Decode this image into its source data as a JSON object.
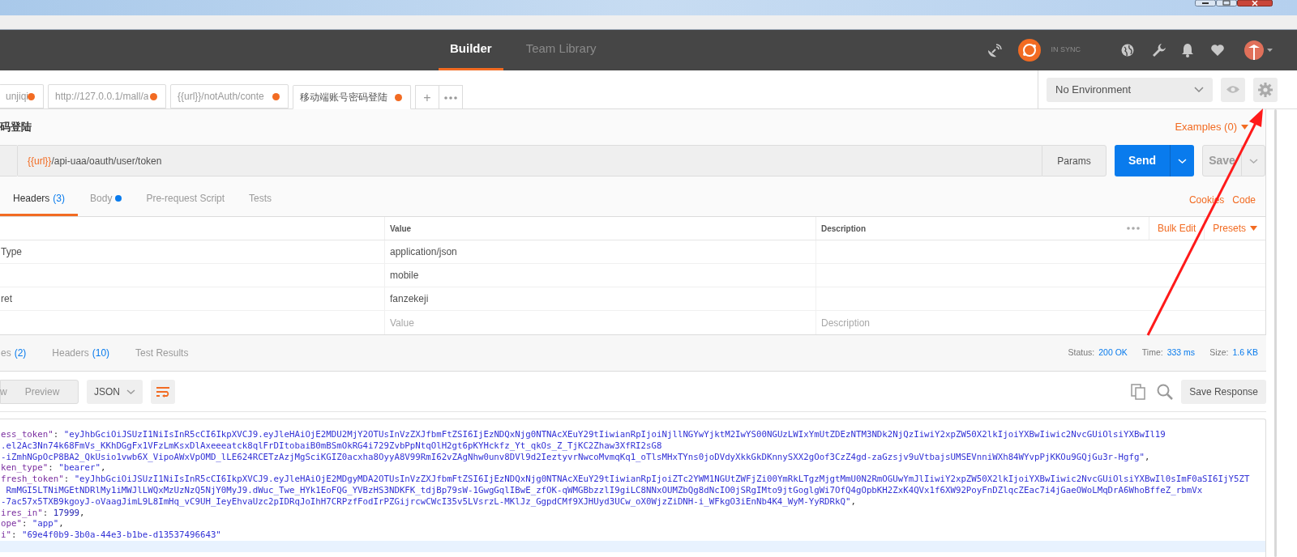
{
  "header": {
    "nav_tabs": [
      {
        "label": "Builder",
        "selected": true
      },
      {
        "label": "Team Library",
        "selected": false
      }
    ],
    "sync_status": "IN SYNC"
  },
  "request_tabs": [
    {
      "label": "unjiqi",
      "unsaved": true,
      "selected": false
    },
    {
      "label": "http://127.0.0.1/mall/a",
      "unsaved": true,
      "selected": false
    },
    {
      "label": "{{url}}/notAuth/conte",
      "unsaved": true,
      "selected": false
    },
    {
      "label": "移动端账号密码登陆",
      "unsaved": true,
      "selected": true
    }
  ],
  "new_tab": "+",
  "environment": {
    "value": "No Environment"
  },
  "request": {
    "title": "码登陆",
    "examples": "Examples (0)",
    "url_variable": "{{url}}",
    "url_path": "/api-uaa/oauth/user/token",
    "params": "Params",
    "send": "Send",
    "save": "Save"
  },
  "editor_tabs": [
    {
      "label": "Headers",
      "count": "(3)",
      "has_content": false,
      "selected": true
    },
    {
      "label": "Body",
      "has_content": true,
      "selected": false
    },
    {
      "label": "Pre-request Script",
      "has_content": false,
      "selected": false
    },
    {
      "label": "Tests",
      "has_content": false,
      "selected": false
    }
  ],
  "editor_links": [
    "Cookies",
    "Code"
  ],
  "headers_table": {
    "columns": [
      "Value",
      "Description"
    ],
    "actions": [
      "Bulk Edit",
      "Presets"
    ],
    "rows": [
      {
        "key": "Type",
        "value": "application/json"
      },
      {
        "value": "mobile"
      },
      {
        "key": "ret",
        "value": "fanzekeji"
      }
    ],
    "new_row": {
      "value_placeholder": "Value",
      "description_placeholder": "Description"
    }
  },
  "response": {
    "tabs": [
      {
        "label": "es",
        "count": "(2)"
      },
      {
        "label": "Headers",
        "count": "(10)"
      },
      {
        "label": "Test Results"
      }
    ],
    "status_label": "Status:",
    "status": "200 OK",
    "time_label": "Time:",
    "time": "333 ms",
    "size_label": "Size:",
    "size": "1.6 KB",
    "view_modes": [
      "w",
      "Preview"
    ],
    "format": "JSON",
    "save": "Save Response",
    "body_lines": [
      [
        {
          "kind": "key",
          "text": "ess_token\""
        },
        {
          "kind": "punct",
          "text": ": "
        },
        {
          "kind": "string",
          "text": "\"eyJhbGciOiJSUzI1NiIsInR5cCI6IkpXVCJ9.eyJleHAiOjE2MDU2MjY2OTUsInVzZXJfbmFtZSI6IjEzNDQxNjg0NTNAcXEuY29tIiwianRpIjoiNjllNGYwYjktM2IwYS00NGUzLWIxYmUtZDEzNTM3NDk2NjQzIiwiY2xpZW50X2lkIjoiYXBwIiwic2NvcGUiOlsiYXBwIl19"
        }
      ],
      [
        {
          "kind": "string",
          "text": ".el2Ac3Nn74k68FmVs_KKhDGgFx1VFzLmKsxDlAxeeeatck8qlFrDItobaiB0mBSmOkRG4i729ZvbPpNtqOlH2gt6pKYHckfz_Yt_qkOs_Z_TjKC2Zhaw3XfRI2sG8"
        }
      ],
      [
        {
          "kind": "string",
          "text": "-iZmhNGpOcP8BA2_QkUsio1vwb6X_VipoAWxVpOMD_lLE624RCETzAzjMgSciKGIZ0acxha8OyyA8V99RmI62vZAgNhw0unv8DVl9d2IeztyvrNwcoMvmqKq1_oTlsMHxTYns0joDVdyXkkGkDKnnySXX2gOof3CzZ4gd-zaGzsjv9uVtbajsUMSEVnniWXh84WYvpPjKKOu9GQjGu3r-Hgfg\""
        },
        {
          "kind": "punct",
          "text": ","
        }
      ],
      [
        {
          "kind": "key",
          "text": "ken_type\""
        },
        {
          "kind": "punct",
          "text": ": "
        },
        {
          "kind": "string",
          "text": "\"bearer\""
        },
        {
          "kind": "punct",
          "text": ","
        }
      ],
      [
        {
          "kind": "key",
          "text": "fresh_token\""
        },
        {
          "kind": "punct",
          "text": ": "
        },
        {
          "kind": "string",
          "text": "\"eyJhbGciOiJSUzI1NiIsInR5cCI6IkpXVCJ9.eyJleHAiOjE2MDgyMDA2OTUsInVzZXJfbmFtZSI6IjEzNDQxNjg0NTNAcXEuY29tIiwianRpIjoiZTc2YWM1NGUtZWFjZi00YmRkLTgzMjgtMmU0N2RmOGUwYmJlIiwiY2xpZW50X2lkIjoiYXBwIiwic2NvcGUiOlsiYXBwIl0sImF0aSI6IjY5ZT"
        }
      ],
      [
        {
          "kind": "string",
          "text": " RmMGI5LTNiMGEtNDRlMy1iMWJlLWQxMzUzNzQ5NjY0MyJ9.dWuc_Twe_HYk1EoFQG_YVBzHS3NDKFK_tdjBp79sW-1GwgGqlIBwE_zfOK-qWMGBbzzlI9giLC8NNxOUMZbQg8dNcIO0jSRgIMto9jtGoglgWi7OfQ4gOpbKH2ZxK4QVx1f6XW92PoyFnDZlqcZEac7i4jGaeOWoLMqDrA6WhoBffeZ_rbmVx"
        }
      ],
      [
        {
          "kind": "string",
          "text": "-7ac57x5TXB9kgoyJ-oVaagJimL9L8ImHq_vC9UH_IeyEhvaUzc2pIDRqJoIhH7CRPzfFodIrPZGijrcwCWcI35v5LVsrzL-MKlJz_GgpdCMf9XJHUyd3UCw_oX0WjzZiDNH-i_WFkgO3iEnNb4K4_WyM-YyRDRkQ\""
        },
        {
          "kind": "punct",
          "text": ","
        }
      ],
      [
        {
          "kind": "key",
          "text": "ires_in\""
        },
        {
          "kind": "punct",
          "text": ": "
        },
        {
          "kind": "number",
          "text": "17999"
        },
        {
          "kind": "punct",
          "text": ","
        }
      ],
      [
        {
          "kind": "key",
          "text": "ope\""
        },
        {
          "kind": "punct",
          "text": ": "
        },
        {
          "kind": "string",
          "text": "\"app\""
        },
        {
          "kind": "punct",
          "text": ","
        }
      ],
      [
        {
          "kind": "key",
          "text": "i\""
        },
        {
          "kind": "punct",
          "text": ": "
        },
        {
          "kind": "string",
          "text": "\"69e4f0b9-3b0a-44e3-b1be-d13537496643\""
        }
      ]
    ]
  }
}
